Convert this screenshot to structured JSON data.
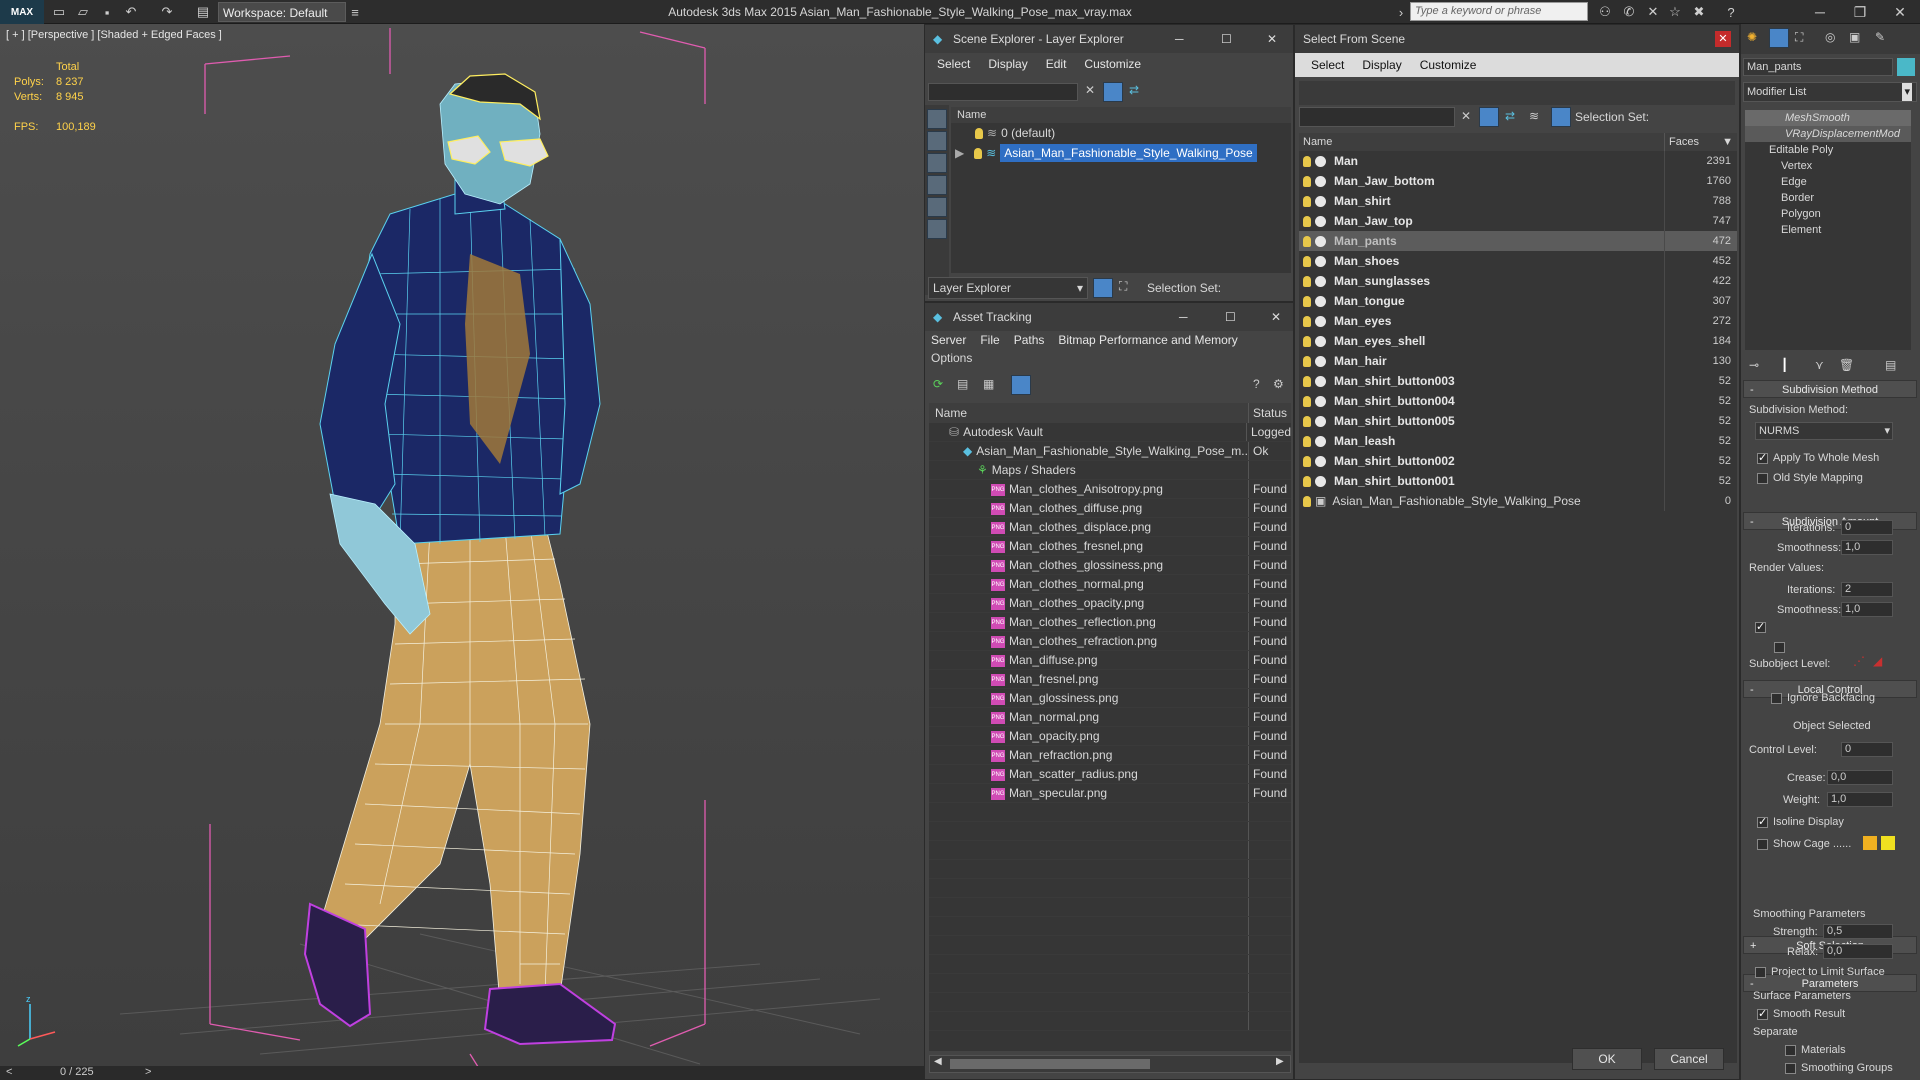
{
  "app": {
    "logo": "MAX",
    "workspace": "Workspace: Default",
    "title": "Autodesk 3ds Max  2015    Asian_Man_Fashionable_Style_Walking_Pose_max_vray.max",
    "search_placeholder": "Type a keyword or phrase"
  },
  "viewport": {
    "label": "[ + ] [Perspective ] [Shaded + Edged Faces ]",
    "stats_total": "Total",
    "polys_label": "Polys:",
    "polys": "8 237",
    "verts_label": "Verts:",
    "verts": "8 945",
    "fps_label": "FPS:",
    "fps": "100,189",
    "timeline": "0 / 225"
  },
  "scene_explorer": {
    "title": "Scene Explorer - Layer Explorer",
    "menu": [
      "Select",
      "Display",
      "Edit",
      "Customize"
    ],
    "col_name": "Name",
    "layers": [
      "0 (default)",
      "Asian_Man_Fashionable_Style_Walking_Pose"
    ],
    "footer_dropdown": "Layer Explorer",
    "footer_selset": "Selection Set:"
  },
  "asset_tracking": {
    "title": "Asset Tracking",
    "menu": [
      "Server",
      "File",
      "Paths",
      "Bitmap Performance and Memory"
    ],
    "menu2": "Options",
    "col_name": "Name",
    "col_status": "Status",
    "rows": [
      {
        "name": "Autodesk Vault",
        "status": "Logged",
        "indent": 1,
        "kind": "vault"
      },
      {
        "name": "Asian_Man_Fashionable_Style_Walking_Pose_m...",
        "status": "Ok",
        "indent": 2,
        "kind": "max"
      },
      {
        "name": "Maps / Shaders",
        "status": "",
        "indent": 3,
        "kind": "folder"
      },
      {
        "name": "Man_clothes_Anisotropy.png",
        "status": "Found",
        "indent": 4,
        "kind": "png"
      },
      {
        "name": "Man_clothes_diffuse.png",
        "status": "Found",
        "indent": 4,
        "kind": "png"
      },
      {
        "name": "Man_clothes_displace.png",
        "status": "Found",
        "indent": 4,
        "kind": "png"
      },
      {
        "name": "Man_clothes_fresnel.png",
        "status": "Found",
        "indent": 4,
        "kind": "png"
      },
      {
        "name": "Man_clothes_glossiness.png",
        "status": "Found",
        "indent": 4,
        "kind": "png"
      },
      {
        "name": "Man_clothes_normal.png",
        "status": "Found",
        "indent": 4,
        "kind": "png"
      },
      {
        "name": "Man_clothes_opacity.png",
        "status": "Found",
        "indent": 4,
        "kind": "png"
      },
      {
        "name": "Man_clothes_reflection.png",
        "status": "Found",
        "indent": 4,
        "kind": "png"
      },
      {
        "name": "Man_clothes_refraction.png",
        "status": "Found",
        "indent": 4,
        "kind": "png"
      },
      {
        "name": "Man_diffuse.png",
        "status": "Found",
        "indent": 4,
        "kind": "png"
      },
      {
        "name": "Man_fresnel.png",
        "status": "Found",
        "indent": 4,
        "kind": "png"
      },
      {
        "name": "Man_glossiness.png",
        "status": "Found",
        "indent": 4,
        "kind": "png"
      },
      {
        "name": "Man_normal.png",
        "status": "Found",
        "indent": 4,
        "kind": "png"
      },
      {
        "name": "Man_opacity.png",
        "status": "Found",
        "indent": 4,
        "kind": "png"
      },
      {
        "name": "Man_refraction.png",
        "status": "Found",
        "indent": 4,
        "kind": "png"
      },
      {
        "name": "Man_scatter_radius.png",
        "status": "Found",
        "indent": 4,
        "kind": "png"
      },
      {
        "name": "Man_specular.png",
        "status": "Found",
        "indent": 4,
        "kind": "png"
      }
    ]
  },
  "select_from_scene": {
    "title": "Select From Scene",
    "menu": [
      "Select",
      "Display",
      "Customize"
    ],
    "selset": "Selection Set:",
    "col_name": "Name",
    "col_faces": "Faces",
    "items": [
      {
        "name": "Man",
        "faces": "2391"
      },
      {
        "name": "Man_Jaw_bottom",
        "faces": "1760"
      },
      {
        "name": "Man_shirt",
        "faces": "788"
      },
      {
        "name": "Man_Jaw_top",
        "faces": "747"
      },
      {
        "name": "Man_pants",
        "faces": "472",
        "selected": true
      },
      {
        "name": "Man_shoes",
        "faces": "452"
      },
      {
        "name": "Man_sunglasses",
        "faces": "422"
      },
      {
        "name": "Man_tongue",
        "faces": "307"
      },
      {
        "name": "Man_eyes",
        "faces": "272"
      },
      {
        "name": "Man_eyes_shell",
        "faces": "184"
      },
      {
        "name": "Man_hair",
        "faces": "130"
      },
      {
        "name": "Man_shirt_button003",
        "faces": "52"
      },
      {
        "name": "Man_shirt_button004",
        "faces": "52"
      },
      {
        "name": "Man_shirt_button005",
        "faces": "52"
      },
      {
        "name": "Man_leash",
        "faces": "52"
      },
      {
        "name": "Man_shirt_button002",
        "faces": "52"
      },
      {
        "name": "Man_shirt_button001",
        "faces": "52"
      },
      {
        "name": "Asian_Man_Fashionable_Style_Walking_Pose",
        "faces": "0",
        "group": true
      }
    ],
    "ok": "OK",
    "cancel": "Cancel"
  },
  "modify": {
    "object_name": "Man_pants",
    "modifier_list": "Modifier List",
    "stack": [
      "MeshSmooth",
      "VRayDisplacementMod",
      "Editable Poly",
      "Vertex",
      "Edge",
      "Border",
      "Polygon",
      "Element"
    ],
    "subdiv_method_head": "Subdivision Method",
    "subdiv_method_label": "Subdivision Method:",
    "subdiv_method_value": "NURMS",
    "apply_whole": "Apply To Whole Mesh",
    "old_style": "Old Style Mapping",
    "subdiv_amount_head": "Subdivision Amount",
    "iterations_label": "Iterations:",
    "iterations": "0",
    "smoothness_label": "Smoothness:",
    "smoothness": "1,0",
    "render_values": "Render Values:",
    "r_iterations_label": "Iterations:",
    "r_iterations": "2",
    "r_smoothness_label": "Smoothness:",
    "r_smoothness": "1,0",
    "local_control_head": "Local Control",
    "subobject_level": "Subobject Level:",
    "ignore_backfacing": "Ignore Backfacing",
    "object_selected": "Object Selected",
    "control_level_label": "Control Level:",
    "control_level": "0",
    "crease_label": "Crease:",
    "crease": "0,0",
    "weight_label": "Weight:",
    "weight": "1,0",
    "isoline": "Isoline Display",
    "show_cage": "Show Cage ......",
    "soft_selection_head": "Soft Selection",
    "parameters_head": "Parameters",
    "smoothing_params": "Smoothing Parameters",
    "strength_label": "Strength:",
    "strength": "0,5",
    "relax_label": "Relax:",
    "relax": "0,0",
    "project_limit": "Project to Limit Surface",
    "surface_params": "Surface Parameters",
    "smooth_result": "Smooth Result",
    "separate": "Separate",
    "materials": "Materials",
    "smoothing_groups": "Smoothing Groups"
  }
}
